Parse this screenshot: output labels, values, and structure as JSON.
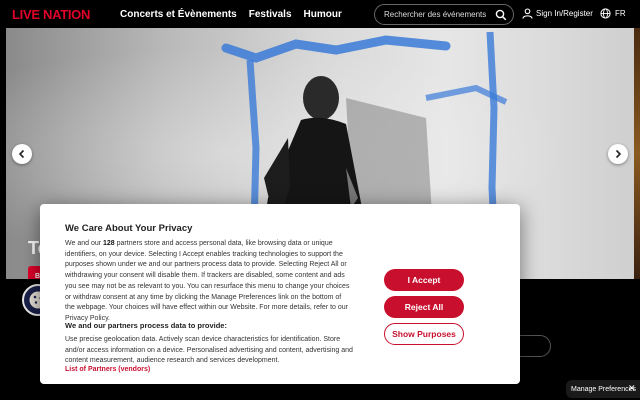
{
  "header": {
    "logo": "LIVE NATION",
    "nav": [
      "Concerts et Évènements",
      "Festivals",
      "Humour"
    ],
    "search_placeholder": "Rechercher des événements",
    "signin": "Sign In/Register",
    "language": "FR"
  },
  "hero": {
    "title_partial": "Te",
    "button_partial": "Bill",
    "prev_icon": "chevron-left-icon",
    "next_icon": "chevron-right-icon"
  },
  "consent": {
    "title": "We Care About Your Privacy",
    "body_pre": "We and our ",
    "partner_count": "128",
    "body_post": " partners store and access personal data, like browsing data or unique identifiers, on your device. Selecting I Accept enables tracking technologies to support the purposes shown under we and our partners process data to provide. Selecting Reject All or withdrawing your consent will disable them. If trackers are disabled, some content and ads you see may not be as relevant to you. You can resurface this menu to change your choices or withdraw consent at any time by clicking the Manage Preferences link on the bottom of the webpage. Your choices will have effect within our Website. For more details, refer to our Privacy Policy.",
    "subtitle": "We and our partners process data to provide:",
    "purposes": "Use precise geolocation data. Actively scan device characteristics for identification. Store and/or access information on a device. Personalised advertising and content, advertising and content measurement, audience research and services development.",
    "partners_link": "List of Partners (vendors)",
    "accept": "I Accept",
    "reject": "Reject All",
    "show_purposes": "Show Purposes"
  },
  "manage_preferences": "Manage Preferences",
  "colors": {
    "brand_red": "#e0002a",
    "consent_red": "#c8102e"
  }
}
